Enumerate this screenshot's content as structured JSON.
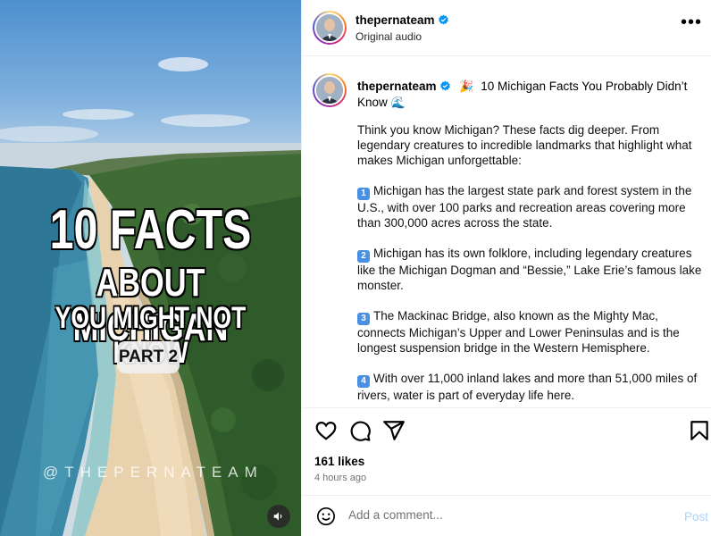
{
  "media": {
    "title_line1": "10 FACTS",
    "title_line2": "ABOUT MICHIGAN",
    "title_line3": "YOU MIGHT NOT KNOW",
    "part_label": "PART 2",
    "watermark": "@THEPERNATEAM",
    "audio_icon": "speaker-icon"
  },
  "header": {
    "username": "thepernateam",
    "subtitle": "Original audio",
    "more_icon": "more-options-icon",
    "more_label": "•••"
  },
  "caption": {
    "username": "thepernateam",
    "title": "10 Michigan Facts You Probably Didn’t Know",
    "title_emoji_before": "🎉",
    "title_emoji_after": "🌊",
    "intro": "Think you know Michigan? These facts dig deeper. From legendary creatures to incredible landmarks that highlight what makes Michigan unforgettable:",
    "facts": [
      {
        "num": "1",
        "text": "Michigan has the largest state park and forest system in the U.S., with over 100 parks and recreation areas covering more than 300,000 acres across the state."
      },
      {
        "num": "2",
        "text": "Michigan has its own folklore, including legendary creatures like the Michigan Dogman and “Bessie,” Lake Erie’s famous lake monster."
      },
      {
        "num": "3",
        "text": "The Mackinac Bridge, also known as the Mighty Mac, connects Michigan’s Upper and Lower Peninsulas and is the longest suspension bridge in the Western Hemisphere."
      },
      {
        "num": "4",
        "text": "With over 11,000 inland lakes and more than 51,000 miles of rivers, water is part of everyday life here."
      }
    ]
  },
  "actions": {
    "like_icon": "heart-icon",
    "comment_icon": "comment-icon",
    "share_icon": "share-icon",
    "save_icon": "bookmark-icon"
  },
  "stats": {
    "likes": "161 likes",
    "time_ago": "4 hours ago"
  },
  "comment": {
    "placeholder": "Add a comment...",
    "post_label": "Post",
    "emoji_icon": "smiley-icon"
  },
  "colors": {
    "verified": "#0095f6",
    "post_disabled": "#a9d4fb",
    "fact_badge": "#4a90e2"
  }
}
